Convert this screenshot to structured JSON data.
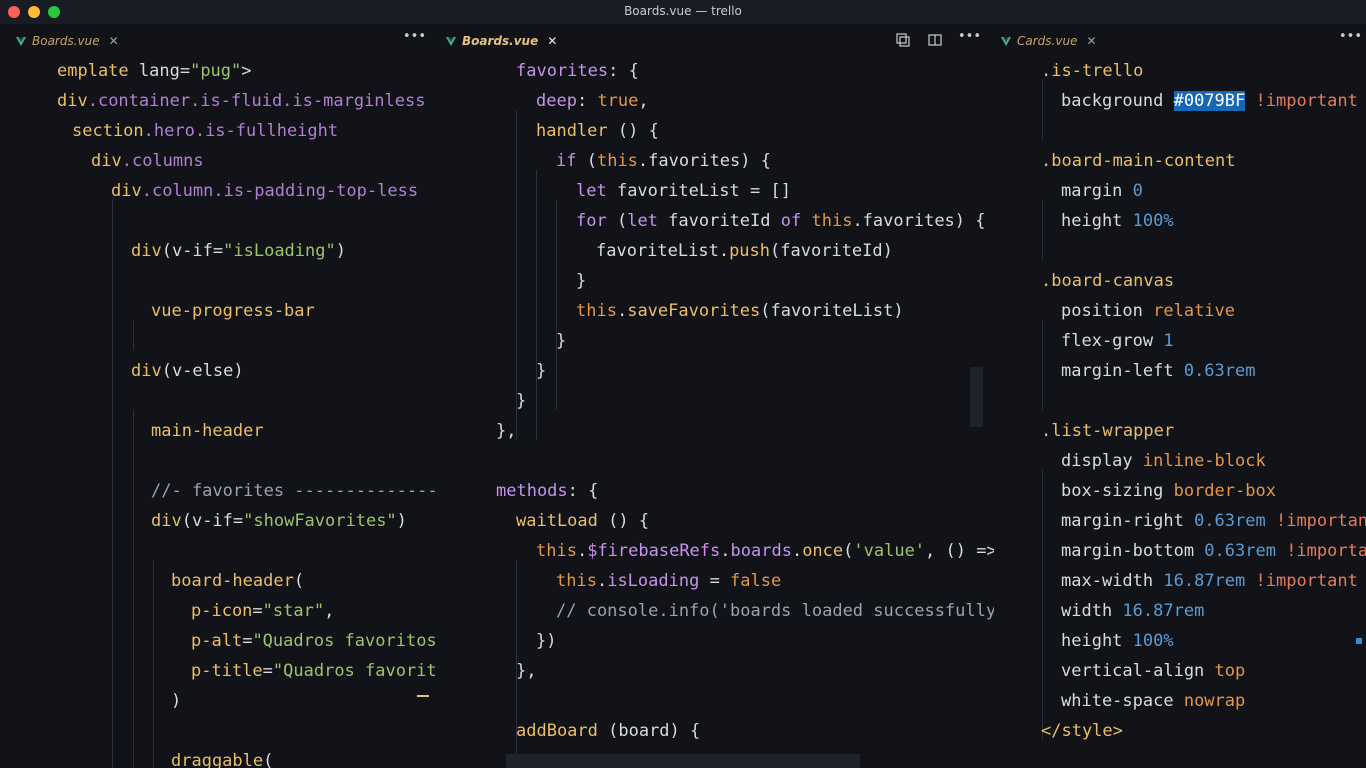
{
  "window": {
    "title": "Boards.vue — trello"
  },
  "colors": {
    "editor_bg": "#111318",
    "tab_active": "#e6c27d",
    "selection": "#1668b6"
  },
  "panes": [
    {
      "tab": {
        "label": "Boards.vue",
        "active": false,
        "icon": "vue-icon"
      },
      "more_label": "•••",
      "lines": [
        [
          [
            "tg",
            "emplate "
          ],
          [
            "prop",
            "lang="
          ],
          [
            "st",
            "\"pug\""
          ],
          [
            "prop",
            ">"
          ]
        ],
        [
          [
            "tg",
            "div"
          ],
          [
            "cl",
            ".container.is-fluid.is-marginless"
          ]
        ],
        [
          [
            "tg",
            "section"
          ],
          [
            "cl",
            ".hero.is-fullheight"
          ]
        ],
        [
          [
            "tg",
            "div"
          ],
          [
            "cl",
            ".columns"
          ]
        ],
        [
          [
            "tg",
            "div"
          ],
          [
            "cl",
            ".column.is-padding-top-less"
          ]
        ],
        [],
        [
          [
            "tg",
            "div"
          ],
          [
            "prop",
            "(v-if="
          ],
          [
            "st",
            "\"isLoading\""
          ],
          [
            "prop",
            ")"
          ]
        ],
        [],
        [
          [
            "tg",
            "vue-progress-bar"
          ]
        ],
        [],
        [
          [
            "tg",
            "div"
          ],
          [
            "prop",
            "(v-else)"
          ]
        ],
        [],
        [
          [
            "tg",
            "main-header"
          ]
        ],
        [],
        [
          [
            "cm",
            "//- favorites --------------"
          ]
        ],
        [
          [
            "tg",
            "div"
          ],
          [
            "prop",
            "(v-if="
          ],
          [
            "st",
            "\"showFavorites\""
          ],
          [
            "prop",
            ")"
          ]
        ],
        [],
        [
          [
            "tg",
            "board-header"
          ],
          [
            "prop",
            "("
          ]
        ],
        [
          [
            "tg",
            "p-icon"
          ],
          [
            "prop",
            "="
          ],
          [
            "st",
            "\"star\""
          ],
          [
            "prop",
            ","
          ]
        ],
        [
          [
            "tg",
            "p-alt"
          ],
          [
            "prop",
            "="
          ],
          [
            "st",
            "\"Quadros favoritos"
          ]
        ],
        [
          [
            "tg",
            "p-title"
          ],
          [
            "prop",
            "="
          ],
          [
            "st",
            "\"Quadros favorit"
          ]
        ],
        [
          [
            "prop",
            ")"
          ]
        ],
        [],
        [
          [
            "tg",
            "draggable"
          ],
          [
            "prop",
            "("
          ]
        ]
      ]
    },
    {
      "tab": {
        "label": "Boards.vue",
        "active": true,
        "icon": "vue-icon"
      },
      "more_label": "•••",
      "lines": [
        [
          [
            "pu",
            "favorites"
          ],
          [
            "prop",
            ": {"
          ]
        ],
        [
          [
            "pu",
            "deep"
          ],
          [
            "prop",
            ": "
          ],
          [
            "op",
            "true"
          ],
          [
            "prop",
            ","
          ]
        ],
        [
          [
            "fn",
            "handler"
          ],
          [
            "prop",
            " () {"
          ]
        ],
        [
          [
            "pu",
            "if"
          ],
          [
            "prop",
            " ("
          ],
          [
            "op",
            "this"
          ],
          [
            "prop",
            ".favorites) {"
          ]
        ],
        [
          [
            "pu",
            "let"
          ],
          [
            "prop",
            " favoriteList = []"
          ]
        ],
        [
          [
            "pu",
            "for"
          ],
          [
            "prop",
            " ("
          ],
          [
            "pu",
            "let"
          ],
          [
            "prop",
            " favoriteId "
          ],
          [
            "pu",
            "of"
          ],
          [
            "prop",
            " "
          ],
          [
            "op",
            "this"
          ],
          [
            "prop",
            ".favorites) {"
          ]
        ],
        [
          [
            "prop",
            "favoriteList."
          ],
          [
            "fn",
            "push"
          ],
          [
            "prop",
            "(favoriteId)"
          ]
        ],
        [
          [
            "prop",
            "}"
          ]
        ],
        [
          [
            "op",
            "this"
          ],
          [
            "prop",
            "."
          ],
          [
            "fn",
            "saveFavorites"
          ],
          [
            "prop",
            "(favoriteList)"
          ]
        ],
        [
          [
            "prop",
            "}"
          ]
        ],
        [
          [
            "prop",
            "}"
          ]
        ],
        [
          [
            "prop",
            "}"
          ]
        ],
        [
          [
            "prop",
            "},"
          ]
        ],
        [],
        [
          [
            "pu",
            "methods"
          ],
          [
            "prop",
            ": {"
          ]
        ],
        [
          [
            "fn",
            "waitLoad"
          ],
          [
            "prop",
            " () {"
          ]
        ],
        [
          [
            "op",
            "this"
          ],
          [
            "prop",
            "."
          ],
          [
            "pu",
            "$firebaseRefs"
          ],
          [
            "prop",
            "."
          ],
          [
            "pu",
            "boards"
          ],
          [
            "prop",
            "."
          ],
          [
            "fn",
            "once"
          ],
          [
            "prop",
            "("
          ],
          [
            "st",
            "'value'"
          ],
          [
            "prop",
            ", () =>"
          ]
        ],
        [
          [
            "op",
            "this"
          ],
          [
            "prop",
            "."
          ],
          [
            "pu",
            "isLoading"
          ],
          [
            "prop",
            " = "
          ],
          [
            "op",
            "false"
          ]
        ],
        [
          [
            "cm",
            "// console.info('boards loaded successfully"
          ]
        ],
        [
          [
            "prop",
            "})"
          ]
        ],
        [
          [
            "prop",
            "},"
          ]
        ],
        [],
        [
          [
            "fn",
            "addBoard"
          ],
          [
            "prop",
            " (board) {"
          ]
        ]
      ]
    },
    {
      "tab": {
        "label": "Cards.vue",
        "active": false,
        "icon": "vue-icon"
      },
      "more_label": "•••",
      "lines": [
        [
          [
            "sel",
            ".is-trello"
          ]
        ],
        [
          [
            "prop",
            "background "
          ],
          [
            "hexsel",
            "#0079BF"
          ],
          [
            "prop",
            " "
          ],
          [
            "imp",
            "!important"
          ]
        ],
        [],
        [
          [
            "sel",
            ".board-main-content"
          ]
        ],
        [
          [
            "prop",
            "margin "
          ],
          [
            "nm",
            "0"
          ]
        ],
        [
          [
            "prop",
            "height "
          ],
          [
            "nm",
            "100%"
          ]
        ],
        [],
        [
          [
            "sel",
            ".board-canvas"
          ]
        ],
        [
          [
            "prop",
            "position "
          ],
          [
            "op",
            "relative"
          ]
        ],
        [
          [
            "prop",
            "flex-grow "
          ],
          [
            "nm",
            "1"
          ]
        ],
        [
          [
            "prop",
            "margin-left "
          ],
          [
            "nm",
            "0.63rem"
          ]
        ],
        [],
        [
          [
            "sel",
            ".list-wrapper"
          ]
        ],
        [
          [
            "prop",
            "display "
          ],
          [
            "op",
            "inline-block"
          ]
        ],
        [
          [
            "prop",
            "box-sizing "
          ],
          [
            "op",
            "border-box"
          ]
        ],
        [
          [
            "prop",
            "margin-right "
          ],
          [
            "nm",
            "0.63rem"
          ],
          [
            "prop",
            " "
          ],
          [
            "imp",
            "!important"
          ]
        ],
        [
          [
            "prop",
            "margin-bottom "
          ],
          [
            "nm",
            "0.63rem"
          ],
          [
            "prop",
            " "
          ],
          [
            "imp",
            "!important"
          ]
        ],
        [
          [
            "prop",
            "max-width "
          ],
          [
            "nm",
            "16.87rem"
          ],
          [
            "prop",
            " "
          ],
          [
            "imp",
            "!important"
          ]
        ],
        [
          [
            "prop",
            "width "
          ],
          [
            "nm",
            "16.87rem"
          ]
        ],
        [
          [
            "prop",
            "height "
          ],
          [
            "nm",
            "100%"
          ]
        ],
        [
          [
            "prop",
            "vertical-align "
          ],
          [
            "op",
            "top"
          ]
        ],
        [
          [
            "prop",
            "white-space "
          ],
          [
            "op",
            "nowrap"
          ]
        ],
        [
          [
            "tg",
            "</style>"
          ]
        ]
      ]
    }
  ]
}
